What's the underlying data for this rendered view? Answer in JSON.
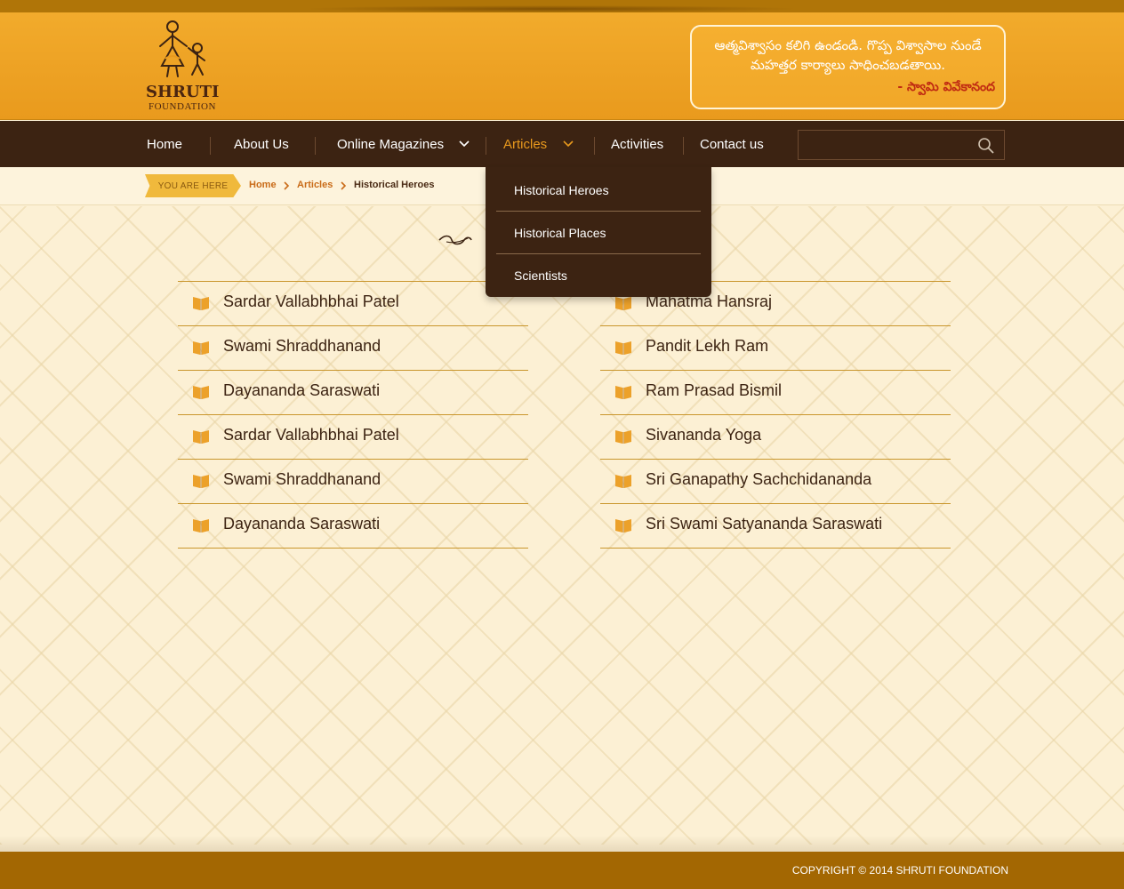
{
  "brand": {
    "name": "SHRUTI",
    "tagline": "FOUNDATION"
  },
  "quote": {
    "text": "ఆత్మవిశ్వాసం కలిగి ఉండండి. గొప్ప విశ్వాసాల నుండే మహత్తర కార్యాలు సాధించబడతాయి.",
    "author": "- స్వామి వివేకానంద"
  },
  "nav": {
    "items": [
      {
        "label": "Home"
      },
      {
        "label": "About Us"
      },
      {
        "label": "Online Magazines"
      },
      {
        "label": "Articles"
      },
      {
        "label": "Activities"
      },
      {
        "label": "Contact us"
      }
    ],
    "search_placeholder": ""
  },
  "dropdown": {
    "items": [
      "Historical Heroes",
      "Historical Places",
      "Scientists"
    ]
  },
  "breadcrumb": {
    "tag": "YOU ARE HERE",
    "items": [
      "Home",
      "Articles",
      "Historical Heroes"
    ]
  },
  "list_left": [
    "Sardar Vallabhbhai Patel",
    "Swami Shraddhanand",
    "Dayananda Saraswati",
    "Sardar Vallabhbhai Patel",
    "Swami Shraddhanand",
    "Dayananda Saraswati"
  ],
  "list_right": [
    "Mahatma Hansraj",
    "Pandit Lekh Ram",
    "Ram Prasad Bismil",
    "Sivananda Yoga",
    "Sri Ganapathy Sachchidananda",
    "Sri Swami Satyananda Saraswati"
  ],
  "footer": {
    "copyright": "COPYRIGHT © 2014 SHRUTI FOUNDATION"
  },
  "colors": {
    "header": "#f2ab2c",
    "navbar": "#3c2312",
    "accent": "#e99a1d",
    "footer": "#a36702"
  }
}
